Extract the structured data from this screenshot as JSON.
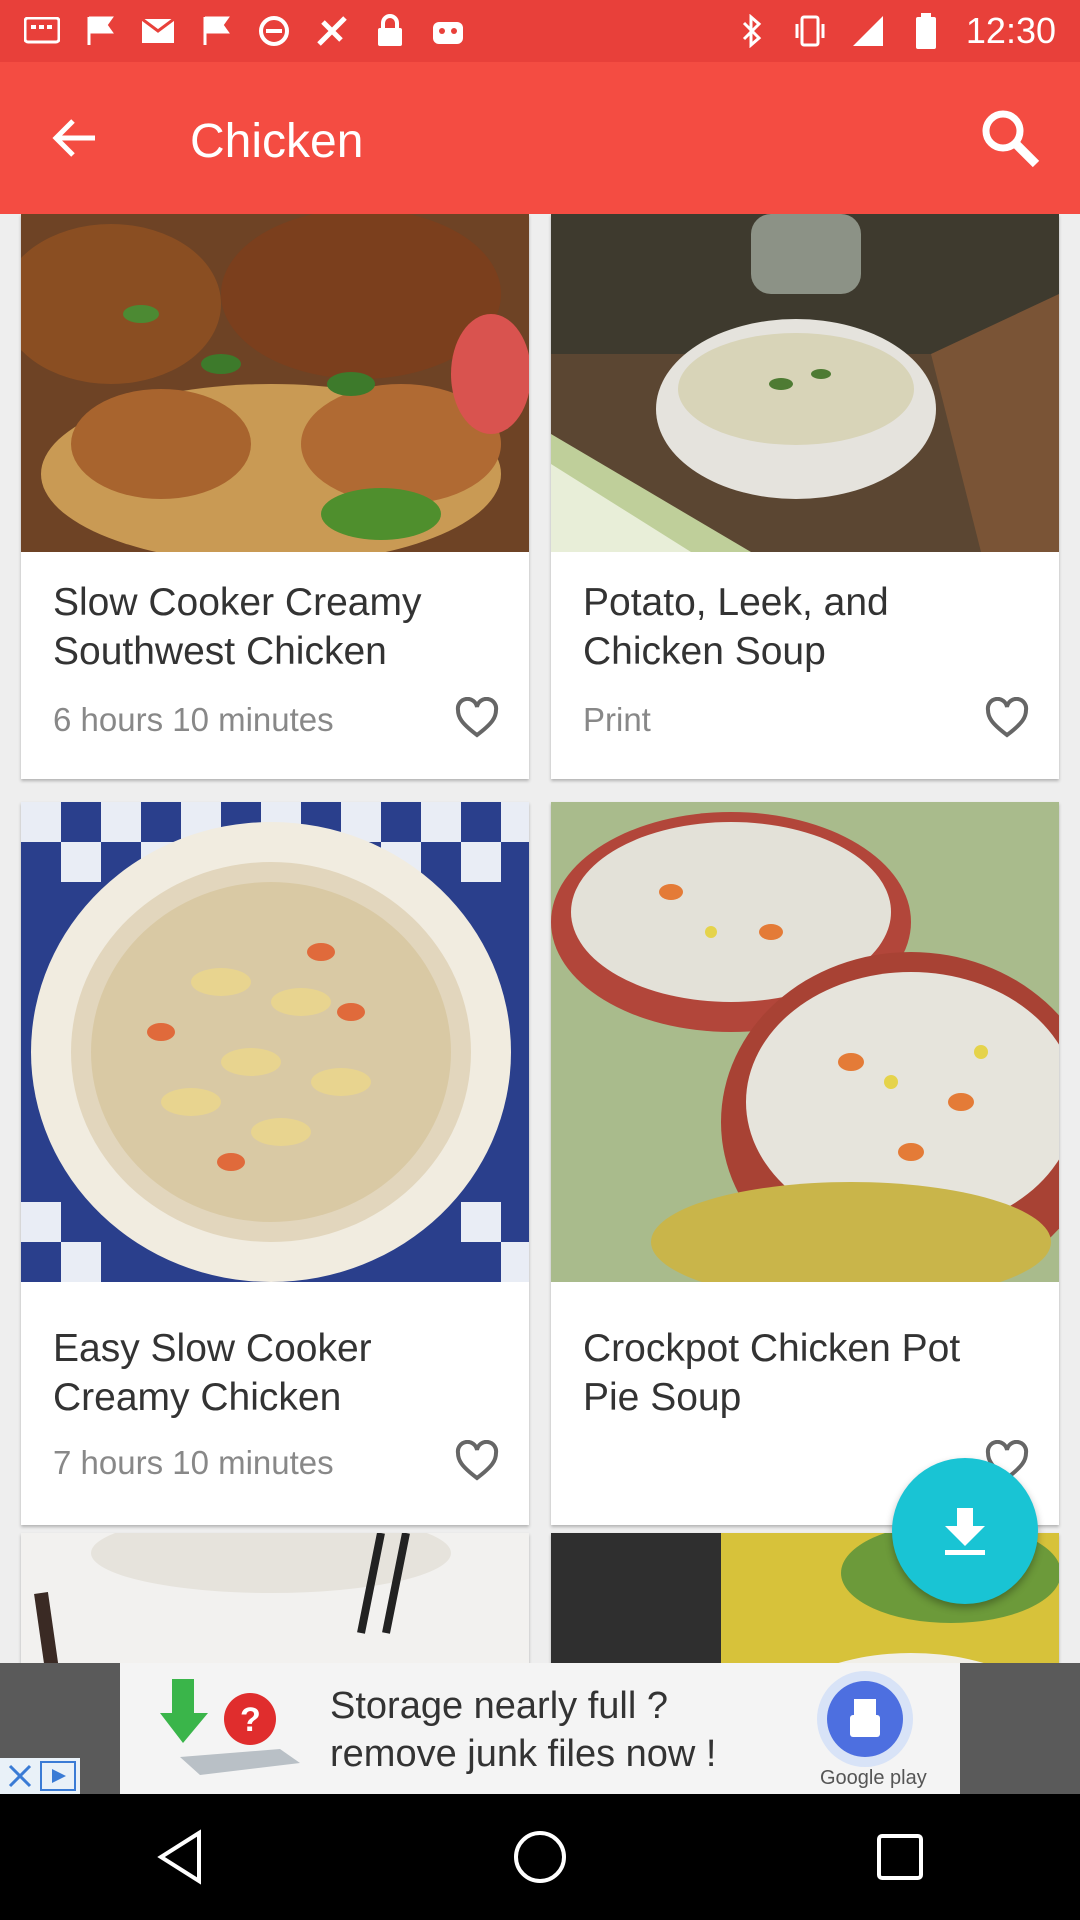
{
  "status_bar": {
    "time": "12:30"
  },
  "app_bar": {
    "title": "Chicken"
  },
  "recipes": [
    {
      "title": "Slow Cooker Creamy Southwest Chicken",
      "meta": "6 hours 10 minutes"
    },
    {
      "title": "Potato, Leek, and Chicken Soup",
      "meta": "Print"
    },
    {
      "title": "Easy Slow Cooker Creamy Chicken",
      "meta": "7 hours 10 minutes"
    },
    {
      "title": "Crockpot Chicken Pot Pie Soup",
      "meta": ""
    }
  ],
  "ad": {
    "line1": "Storage nearly full ?",
    "line2": "remove junk files now !",
    "store": "Google play"
  },
  "colors": {
    "app_bar": "#f44c42",
    "status_bar": "#e8403a",
    "fab": "#19c4d4"
  }
}
